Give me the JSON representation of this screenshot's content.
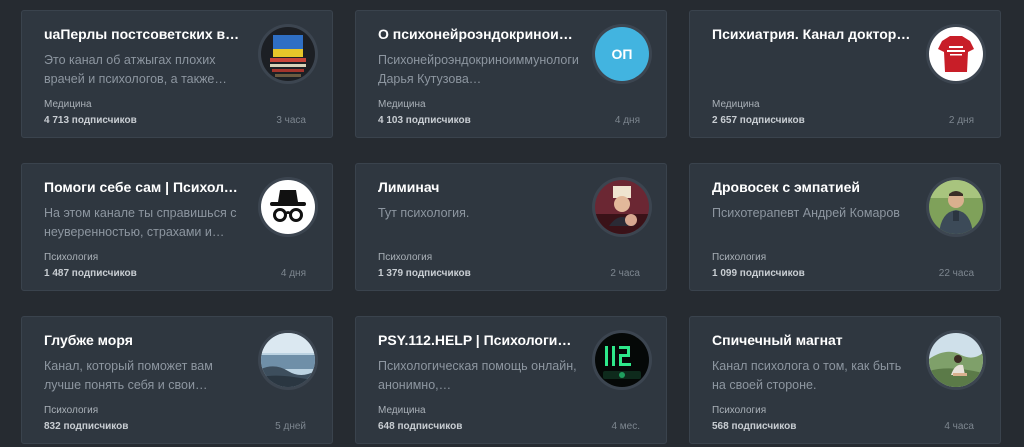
{
  "colors": {
    "background": "#262b31",
    "card": "#2f3740",
    "title": "#ffffff",
    "description": "#8d96a0",
    "initials_avatar": "#42b4e0"
  },
  "cards": [
    {
      "title": "uaПерлы постсоветских вра…",
      "description": "Это канал об атжыгах плохих врачей и психологов, а также…",
      "category": "Медицина",
      "subscribers": "4 713 подписчиков",
      "time": "3 часа",
      "avatar_icon": "protest-sign-photo"
    },
    {
      "title": "О психонейроэндокриноим…",
      "description": "Психонейроэндокриноиммунология: Дарья Кутузова…",
      "category": "Медицина",
      "subscribers": "4 103 подписчиков",
      "time": "4 дня",
      "avatar_initials": "ОП"
    },
    {
      "title": "Психиатрия. Канал доктора…",
      "description": "",
      "category": "Медицина",
      "subscribers": "2 657 подписчиков",
      "time": "2 дня",
      "avatar_icon": "red-tshirt-photo"
    },
    {
      "title": "Помоги себе сам | Психолог…",
      "description": "На этом канале ты справишься с неуверенностью, страхами и…",
      "category": "Психология",
      "subscribers": "1 487 подписчиков",
      "time": "4 дня",
      "avatar_icon": "incognito-icon"
    },
    {
      "title": "Лиминач",
      "description": "Тут психология.",
      "category": "Психология",
      "subscribers": "1 379 подписчиков",
      "time": "2 часа",
      "avatar_icon": "figure-photo"
    },
    {
      "title": "Дровосек с эмпатией",
      "description": "Психотерапевт Андрей Комаров",
      "category": "Психология",
      "subscribers": "1 099 подписчиков",
      "time": "22 часа",
      "avatar_icon": "man-portrait-photo"
    },
    {
      "title": "Глубже моря",
      "description": "Канал, который поможет вам лучше понять себя и свои…",
      "category": "Психология",
      "subscribers": "832 подписчиков",
      "time": "5 дней",
      "avatar_icon": "sea-landscape-photo"
    },
    {
      "title": "PSY.112.HELP | Психологич…",
      "description": "Психологическая помощь онлайн, анонимно,…",
      "category": "Медицина",
      "subscribers": "648 подписчиков",
      "time": "4 мес.",
      "avatar_icon": "digital-display-112-icon"
    },
    {
      "title": "Спичечный магнат",
      "description": "Канал психолога о том, как быть на своей стороне.",
      "category": "Психология",
      "subscribers": "568 подписчиков",
      "time": "4 часа",
      "avatar_icon": "person-on-hill-photo"
    }
  ]
}
